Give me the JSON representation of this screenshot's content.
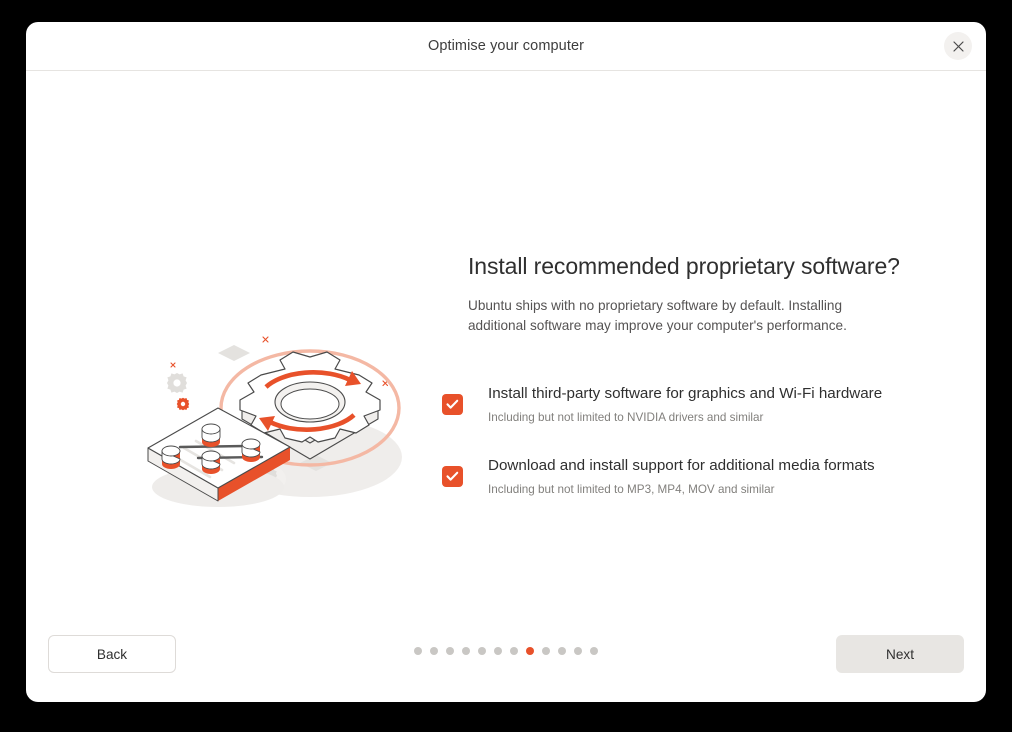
{
  "window": {
    "title": "Optimise your computer",
    "close_icon": "close-icon"
  },
  "page": {
    "heading": "Install recommended proprietary software?",
    "description": "Ubuntu ships with no proprietary software by default. Installing additional software may improve your computer's performance."
  },
  "options": [
    {
      "label": "Install third-party software for graphics and Wi-Fi hardware",
      "sublabel": "Including but not limited to NVIDIA drivers and similar",
      "checked": true
    },
    {
      "label": "Download and install support for additional media formats",
      "sublabel": "Including but not limited to MP3, MP4, MOV and similar",
      "checked": true
    }
  ],
  "footer": {
    "back_label": "Back",
    "next_label": "Next",
    "pager": {
      "total": 12,
      "active_index": 7
    }
  },
  "illustration": {
    "name": "settings-gear-illustration"
  },
  "colors": {
    "accent": "#e8512a",
    "accent_light": "#f6c3b3",
    "text": "#2f2f2f",
    "muted_text": "#82807d",
    "dot_inactive": "#c9c7c4",
    "button_fill": "#e8e6e3",
    "border": "#dedbd8",
    "illustration_gray": "#e9e7e5",
    "illustration_outline": "#4a4a4a"
  }
}
